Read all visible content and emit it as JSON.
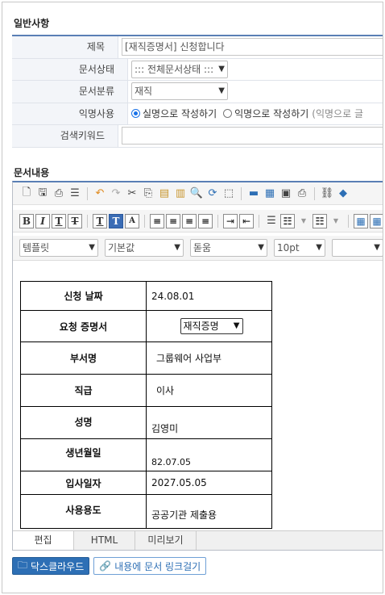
{
  "general": {
    "title": "일반사항",
    "rows": [
      {
        "label": "제목",
        "value": "[재직증명서] 신청합니다"
      },
      {
        "label": "문서상태",
        "value": "::: 전체문서상태 :::"
      },
      {
        "label": "문서분류",
        "value": "재직"
      },
      {
        "label": "익명사용",
        "opt_real": "실명으로 작성하기",
        "opt_anon": "익명으로 작성하기",
        "note": "(익명으로 글"
      },
      {
        "label": "검색키워드",
        "value": ""
      }
    ]
  },
  "content_title": "문서내용",
  "editor": {
    "selects": {
      "template": "템플릿",
      "style": "기본값",
      "font": "돋움",
      "size": "10pt",
      "extra": ""
    },
    "table": [
      {
        "k": "신청 날짜",
        "v": "24.08.01"
      },
      {
        "k": "요청 증명서",
        "v": "재직증명"
      },
      {
        "k": "부서명",
        "v": "그룹웨어 사업부"
      },
      {
        "k": "직급",
        "v": "이사"
      },
      {
        "k": "성명",
        "v": "김영미"
      },
      {
        "k": "생년월일",
        "v": "82.07.05"
      },
      {
        "k": "입사일자",
        "v": "2027.05.05"
      },
      {
        "k": "사용용도",
        "v": "공공기관 제출용"
      }
    ],
    "tabs": [
      "편집",
      "HTML",
      "미리보기"
    ]
  },
  "buttons": {
    "cloud": "닥스클라우드",
    "link": "내용에 문서 링크걸기"
  },
  "colors": {
    "accent": "#2d6fb5",
    "border": "#5a7fb5"
  }
}
